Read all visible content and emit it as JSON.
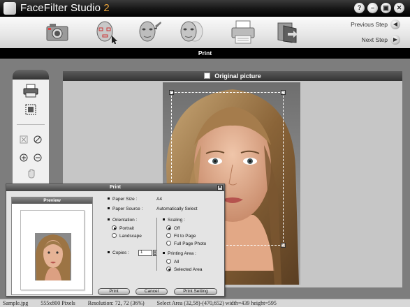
{
  "app": {
    "title_main": "FaceFilter Studio",
    "title_version": "2"
  },
  "window_buttons": [
    "?",
    "–",
    "▣",
    "✕"
  ],
  "toolbar": {
    "tools": [
      {
        "icon": "camera-icon"
      },
      {
        "icon": "face-select-icon"
      },
      {
        "icon": "face-filter-icon"
      },
      {
        "icon": "face-compare-icon"
      },
      {
        "icon": "printer-icon"
      },
      {
        "icon": "exit-icon"
      }
    ],
    "previous_step": "Previous Step",
    "next_step": "Next Step"
  },
  "step_title": "Print",
  "left_panel": {
    "tools": [
      "print-tool-icon",
      "crop-tool-icon",
      "fit-icon",
      "no-icon",
      "zoom-in-icon",
      "zoom-out-icon",
      "hand-icon"
    ]
  },
  "canvas": {
    "header": "Original picture"
  },
  "status_bar": {
    "file": "Sample.jpg",
    "pixels": "555x800 Pixels",
    "resolution": "Resolution: 72, 72 (36%)",
    "select_area": "Select Area (32,58)-(470,652) width=439  height=595"
  },
  "print_dialog": {
    "title": "Print",
    "preview_label": "Preview",
    "paper_size_label": "Paper Size :",
    "paper_size_value": "A4",
    "paper_source_label": "Paper Source :",
    "paper_source_value": "Automatically Select",
    "orientation_label": "Orientation :",
    "orientation_options": [
      "Portrait",
      "Landscape"
    ],
    "orientation_selected": "Portrait",
    "copies_label": "Copies :",
    "copies_value": "1",
    "scaling_label": "Scaling :",
    "scaling_options": [
      "Off",
      "Fit to Page",
      "Full Page Photo"
    ],
    "scaling_selected": "Off",
    "printing_area_label": "Printing Area :",
    "printing_area_options": [
      "All",
      "Selected Area"
    ],
    "printing_area_selected": "Selected Area",
    "buttons": {
      "print": "Print",
      "cancel": "Cancel",
      "print_setting": "Print Setting"
    }
  }
}
